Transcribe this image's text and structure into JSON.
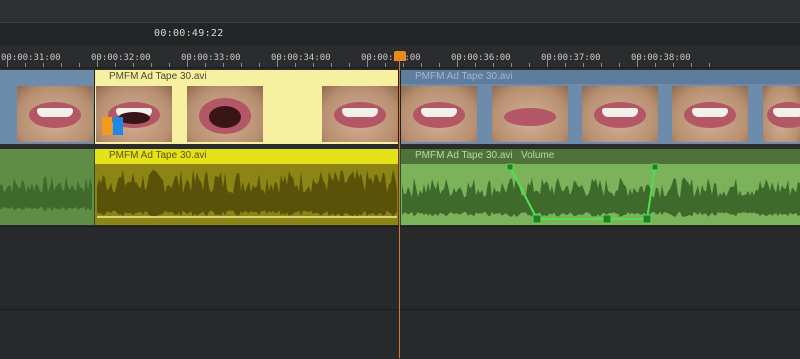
{
  "timecode": "00:00:49:22",
  "ruler": {
    "labels": [
      "00:00:31:00",
      "00:00:32:00",
      "00:00:33:00",
      "00:00:34:00",
      "00:00:35:00",
      "00:00:36:00",
      "00:00:37:00",
      "00:00:38:00"
    ]
  },
  "video_track": {
    "clips": [
      {
        "title": "PMFM Ad Tape 30.avi",
        "state": "selected"
      },
      {
        "title": "PMFM Ad Tape 30.avi",
        "state": "normal"
      }
    ]
  },
  "audio_track": {
    "clips": [
      {
        "title": "PMFM Ad Tape 30.avi",
        "state": "selected"
      },
      {
        "title": "PMFM Ad Tape 30.avi",
        "suffix": "Volume",
        "state": "normal"
      }
    ]
  },
  "colors": {
    "playhead": "#e88a1e",
    "selected_clip_header": "#f6f0a0",
    "video_clip": "#6d8bab",
    "audio_clip": "#7cb25a",
    "volume_line": "#4fe04f",
    "marker_orange": "#f29a1e",
    "marker_blue": "#1e88e5"
  }
}
